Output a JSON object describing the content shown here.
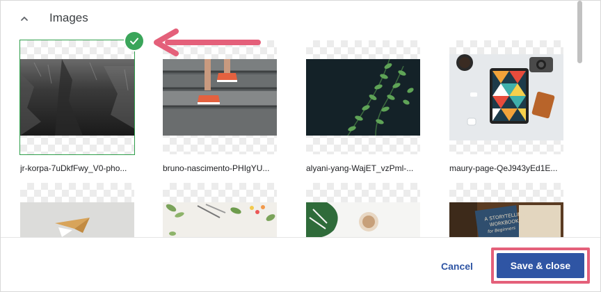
{
  "section": {
    "title": "Images",
    "collapse_icon": "chevron-up-icon"
  },
  "images": [
    {
      "filename": "jr-korpa-7uDkfFwy_V0-pho...",
      "selected": true
    },
    {
      "filename": "bruno-nascimento-PHIgYU..."
    },
    {
      "filename": "alyani-yang-WajET_vzPml-..."
    },
    {
      "filename": "maury-page-QeJ943yEd1E..."
    },
    {
      "filename": ""
    },
    {
      "filename": ""
    },
    {
      "filename": ""
    },
    {
      "filename": ""
    }
  ],
  "selection_icon": "check-circle-icon",
  "annotation": {
    "icon": "arrow-left-icon",
    "color": "#e4607a"
  },
  "footer": {
    "cancel_label": "Cancel",
    "save_label": "Save & close",
    "accent_color": "#2f55a4"
  }
}
